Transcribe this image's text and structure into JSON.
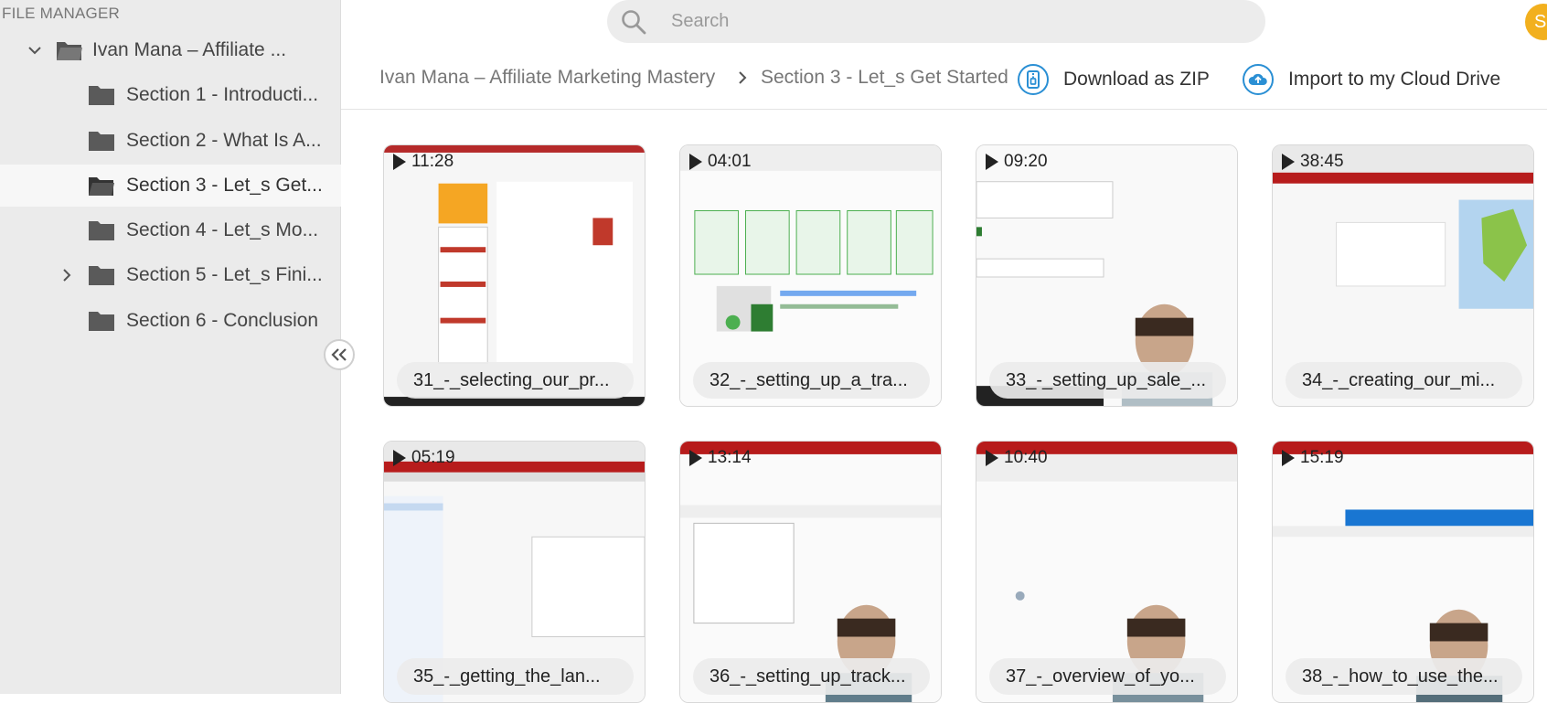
{
  "sidebar": {
    "heading": "FILE MANAGER",
    "root": {
      "label": "Ivan Mana – Affiliate ...",
      "expanded": true
    },
    "items": [
      {
        "label": "Section 1 - Introducti...",
        "selected": false,
        "has_children": false
      },
      {
        "label": "Section 2 - What Is A...",
        "selected": false,
        "has_children": false
      },
      {
        "label": "Section 3 - Let_s Get...",
        "selected": true,
        "has_children": false
      },
      {
        "label": "Section 4 - Let_s Mo...",
        "selected": false,
        "has_children": false
      },
      {
        "label": "Section 5 - Let_s Fini...",
        "selected": false,
        "has_children": true
      },
      {
        "label": "Section 6 - Conclusion",
        "selected": false,
        "has_children": false
      }
    ]
  },
  "search": {
    "placeholder": "Search",
    "value": ""
  },
  "user": {
    "avatar_initial": "S",
    "avatar_color": "#f2b01e"
  },
  "breadcrumb": {
    "items": [
      "Ivan Mana – Affiliate Marketing Mastery",
      "Section 3 - Let_s Get Started"
    ]
  },
  "actions": {
    "download_label": "Download as ZIP",
    "import_label": "Import to my Cloud Drive",
    "accent_color": "#2a8fd4"
  },
  "videos": [
    {
      "duration": "11:28",
      "name": "31_-_selecting_our_pr...",
      "thumb": "marketplace"
    },
    {
      "duration": "04:01",
      "name": "32_-_setting_up_a_tra...",
      "thumb": "clickmagick"
    },
    {
      "duration": "09:20",
      "name": "33_-_setting_up_sale_...",
      "thumb": "webcam"
    },
    {
      "duration": "38:45",
      "name": "34_-_creating_our_mi...",
      "thumb": "ads-map"
    },
    {
      "duration": "05:19",
      "name": "35_-_getting_the_lan...",
      "thumb": "ads-settings"
    },
    {
      "duration": "13:14",
      "name": "36_-_setting_up_track...",
      "thumb": "ads-table-webcam"
    },
    {
      "duration": "10:40",
      "name": "37_-_overview_of_yo...",
      "thumb": "loading-webcam"
    },
    {
      "duration": "15:19",
      "name": "38_-_how_to_use_the...",
      "thumb": "keywords-webcam"
    }
  ]
}
